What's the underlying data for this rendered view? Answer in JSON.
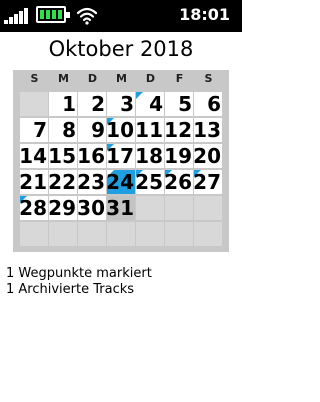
{
  "status_bar": {
    "time": "18:01",
    "icons": [
      "signal-strength-icon",
      "battery-full-icon",
      "wifi-icon"
    ],
    "colors": {
      "background": "#000000",
      "battery_fill": "#2ee04b"
    }
  },
  "calendar": {
    "month_title": "Oktober 2018",
    "weekdays": [
      "S",
      "M",
      "D",
      "M",
      "D",
      "F",
      "S"
    ],
    "days": [
      "1",
      "2",
      "3",
      "4",
      "5",
      "6",
      "7",
      "8",
      "9",
      "10",
      "11",
      "12",
      "13",
      "14",
      "15",
      "16",
      "17",
      "18",
      "19",
      "20",
      "21",
      "22",
      "23",
      "24",
      "25",
      "26",
      "27",
      "28",
      "29",
      "30",
      "31"
    ],
    "first_weekday_index": 1,
    "selected_day": "24",
    "marked_days": [
      "4",
      "10",
      "17",
      "24",
      "25",
      "26",
      "27",
      "28"
    ],
    "colors": {
      "accent": "#1f9fe0",
      "grid_background": "#c8c8c8",
      "empty_cell": "#d8d8d8"
    }
  },
  "summary": {
    "lines": [
      "1 Wegpunkte markiert",
      "1 Archivierte Tracks"
    ]
  }
}
